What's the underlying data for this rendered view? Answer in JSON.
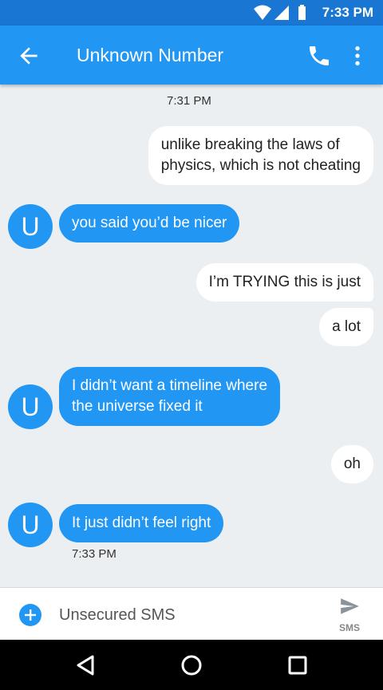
{
  "status_bar": {
    "time": "7:33 PM",
    "icons": [
      "wifi-icon",
      "signal-icon",
      "battery-icon"
    ]
  },
  "app_bar": {
    "title": "Unknown Number",
    "icons": [
      "back-arrow-icon",
      "phone-icon",
      "more-vert-icon"
    ]
  },
  "thread": {
    "top_timestamp": "7:31 PM",
    "messages": [
      {
        "direction": "outgoing",
        "lines": [
          "unlike breaking the laws of",
          "physics, which is not cheating"
        ]
      },
      {
        "direction": "incoming",
        "avatar": "U",
        "lines": [
          "you said you’d be nicer"
        ]
      },
      {
        "direction": "outgoing",
        "lines": [
          "I’m TRYING this is just"
        ]
      },
      {
        "direction": "outgoing",
        "lines": [
          "a lot"
        ]
      },
      {
        "direction": "incoming",
        "avatar": "U",
        "lines": [
          "I didn’t want a timeline where",
          "the universe fixed it"
        ]
      },
      {
        "direction": "outgoing",
        "lines": [
          "oh"
        ]
      },
      {
        "direction": "incoming",
        "avatar": "U",
        "lines": [
          "It just didn’t feel right"
        ]
      }
    ],
    "bottom_timestamp": "7:33 PM"
  },
  "compose": {
    "placeholder": "Unsecured SMS",
    "send_label": "SMS"
  },
  "nav_bar": {
    "icons": [
      "back-triangle-icon",
      "home-circle-icon",
      "recents-square-icon"
    ]
  },
  "colors": {
    "status_bar": "#1976d2",
    "app_bar": "#2196f3",
    "incoming_bubble": "#2196f3",
    "outgoing_bubble": "#ffffff",
    "background": "#eceff1"
  }
}
